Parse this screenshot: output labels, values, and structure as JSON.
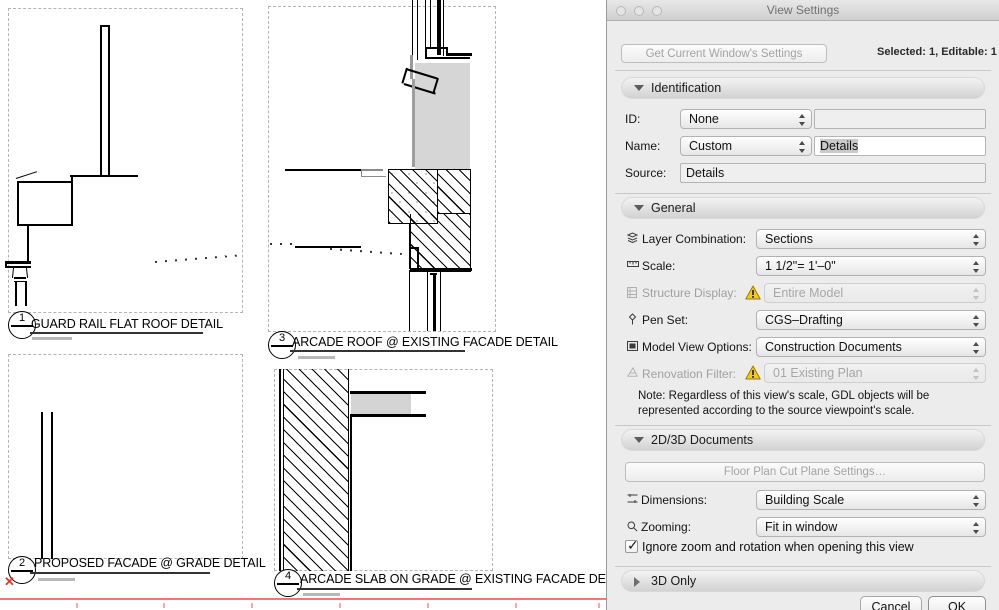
{
  "window": {
    "title": "View Settings",
    "traffic_lights": [
      "close-button",
      "minimize-button",
      "zoom-button"
    ]
  },
  "toolbar": {
    "get_current_settings_label": "Get Current Window's Settings",
    "selection_status": "Selected: 1, Editable: 1"
  },
  "sections": {
    "identification": {
      "title": "Identification",
      "expanded": true,
      "fields": {
        "id_label": "ID:",
        "id_value": "None",
        "id_text": "",
        "name_label": "Name:",
        "name_value": "Custom",
        "name_text": "Details",
        "source_label": "Source:",
        "source_text": "Details"
      }
    },
    "general": {
      "title": "General",
      "expanded": true,
      "fields": [
        {
          "label": "Layer Combination:",
          "value": "Sections",
          "icon": "layers-icon",
          "disabled": false,
          "warning": false
        },
        {
          "label": "Scale:",
          "value": "1 1/2\"=    1'–0\"",
          "icon": "scale-icon",
          "disabled": false,
          "warning": false
        },
        {
          "label": "Structure Display:",
          "value": "Entire Model",
          "icon": "structure-icon",
          "disabled": true,
          "warning": true
        },
        {
          "label": "Pen Set:",
          "value": "CGS–Drafting",
          "icon": "pen-icon",
          "disabled": false,
          "warning": false
        },
        {
          "label": "Model View Options:",
          "value": "Construction Documents",
          "icon": "model-view-icon",
          "disabled": false,
          "warning": false
        },
        {
          "label": "Renovation Filter:",
          "value": "01 Existing Plan",
          "icon": "renovation-icon",
          "disabled": true,
          "warning": true
        }
      ],
      "note": "Note: Regardless of this view's scale, GDL objects will be represented according to the source viewpoint's scale."
    },
    "documents_2d3d": {
      "title": "2D/3D Documents",
      "expanded": true,
      "cut_plane_button": "Floor Plan Cut Plane Settings…",
      "fields": [
        {
          "label": "Dimensions:",
          "value": "Building Scale",
          "icon": "dimensions-icon"
        },
        {
          "label": "Zooming:",
          "value": "Fit in window",
          "icon": "magnifier-icon"
        }
      ],
      "checkbox_label": "Ignore zoom and rotation when opening this view",
      "checkbox_checked": true
    },
    "three_d_only": {
      "title": "3D Only",
      "expanded": false
    }
  },
  "footer": {
    "cancel_label": "Cancel",
    "ok_label": "OK"
  },
  "drawing": {
    "details": [
      {
        "number": "1",
        "title": "GUARD RAIL FLAT ROOF DETAIL"
      },
      {
        "number": "2",
        "title": "PROPOSED FACADE @ GRADE DETAIL"
      },
      {
        "number": "3",
        "title": "ARCADE ROOF @ EXISTING FACADE DETAIL"
      },
      {
        "number": "4",
        "title": "ARCADE SLAB ON GRADE @ EXISTING FACADE DETAIL"
      }
    ]
  },
  "colors": {
    "dialog_bg": "#ececec",
    "section_header": "#e3e3e3",
    "warning_yellow": "#f5c518",
    "grade_line": "#f4766c",
    "marker_red": "#e8342a",
    "hatch_black": "#000000",
    "fill_gray": "#d4d4d4"
  }
}
